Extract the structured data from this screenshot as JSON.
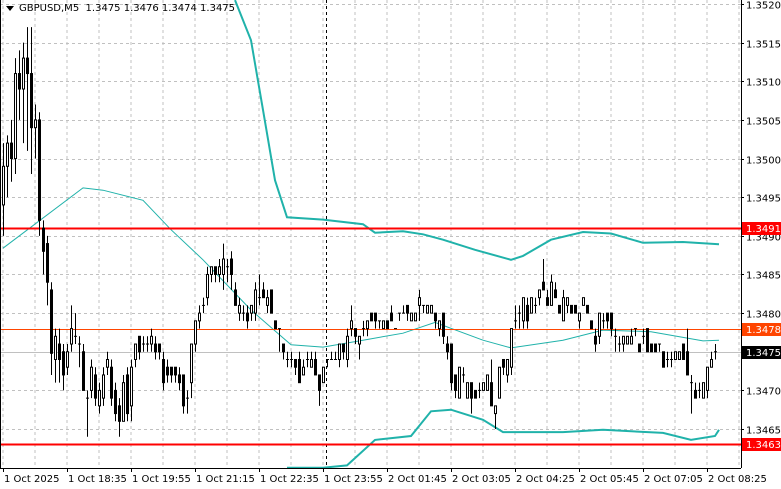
{
  "header": {
    "symbol": "GBPUSD,M5",
    "ohlc": "1.3475 1.3476 1.3474 1.3475"
  },
  "chart_data": {
    "type": "candlestick",
    "symbol": "GBPUSD",
    "timeframe": "M5",
    "ylim": [
      1.346,
      1.3521
    ],
    "grid": true,
    "y_ticks": [
      "1.3520",
      "1.3515",
      "1.3510",
      "1.3505",
      "1.3500",
      "1.3495",
      "1.3490",
      "1.3485",
      "1.3480",
      "1.3475",
      "1.3470",
      "1.3465"
    ],
    "x_ticks": [
      {
        "bar": 0,
        "label": "1 Oct 2025"
      },
      {
        "bar": 16,
        "label": "1 Oct 18:35"
      },
      {
        "bar": 32,
        "label": "1 Oct 19:55"
      },
      {
        "bar": 48,
        "label": "1 Oct 21:15"
      },
      {
        "bar": 64,
        "label": "1 Oct 22:35"
      },
      {
        "bar": 80,
        "label": "1 Oct 23:55"
      },
      {
        "bar": 96,
        "label": "2 Oct 01:45"
      },
      {
        "bar": 112,
        "label": "2 Oct 03:05"
      },
      {
        "bar": 128,
        "label": "2 Oct 04:25"
      },
      {
        "bar": 144,
        "label": "2 Oct 05:45"
      },
      {
        "bar": 160,
        "label": "2 Oct 07:05"
      },
      {
        "bar": 176,
        "label": "2 Oct 08:25"
      }
    ],
    "day_separator_bar": 81,
    "levels": [
      {
        "price": "1.3491",
        "color": "#ff0000",
        "style": "thick"
      },
      {
        "price": "1.3478",
        "color": "#ff4500",
        "style": "thin"
      },
      {
        "price": "1.3463",
        "color": "#ff0000",
        "style": "thick"
      }
    ],
    "bid": {
      "price": "1.3475",
      "color": "#000000"
    },
    "colors": {
      "band": "#20b2aa",
      "bull_fill": "#ffffff",
      "bear_fill": "#000000",
      "grid": "#c0c0c0"
    },
    "bands": {
      "middle": [
        [
          0,
          1.34884
        ],
        [
          20,
          1.34962
        ],
        [
          25,
          1.34959
        ],
        [
          35,
          1.34946
        ],
        [
          42,
          1.34908
        ],
        [
          50,
          1.34869
        ],
        [
          62,
          1.34804
        ],
        [
          72,
          1.34759
        ],
        [
          80,
          1.34756
        ],
        [
          90,
          1.34765
        ],
        [
          100,
          1.34774
        ],
        [
          108,
          1.34788
        ],
        [
          120,
          1.34765
        ],
        [
          127,
          1.34755
        ],
        [
          140,
          1.34765
        ],
        [
          150,
          1.34778
        ],
        [
          162,
          1.34776
        ],
        [
          175,
          1.34764
        ],
        [
          179,
          1.34765
        ]
      ],
      "upper": [
        [
          58,
          1.35205
        ],
        [
          62,
          1.35153
        ],
        [
          65,
          1.35063
        ],
        [
          68,
          1.34972
        ],
        [
          71,
          1.34924
        ],
        [
          80,
          1.34921
        ],
        [
          90,
          1.34915
        ],
        [
          93,
          1.34904
        ],
        [
          100,
          1.34906
        ],
        [
          105,
          1.34902
        ],
        [
          110,
          1.34895
        ],
        [
          118,
          1.34882
        ],
        [
          127,
          1.34869
        ],
        [
          130,
          1.34874
        ],
        [
          137,
          1.34895
        ],
        [
          145,
          1.34905
        ],
        [
          152,
          1.34903
        ],
        [
          160,
          1.34891
        ],
        [
          170,
          1.34892
        ],
        [
          179,
          1.34889
        ]
      ],
      "lower": [
        [
          71,
          1.346
        ],
        [
          80,
          1.346
        ],
        [
          86,
          1.34603
        ],
        [
          93,
          1.34636
        ],
        [
          102,
          1.34641
        ],
        [
          107,
          1.34673
        ],
        [
          112,
          1.34675
        ],
        [
          120,
          1.34662
        ],
        [
          125,
          1.34646
        ],
        [
          140,
          1.34646
        ],
        [
          150,
          1.34649
        ],
        [
          165,
          1.34645
        ],
        [
          172,
          1.34636
        ],
        [
          178,
          1.34641
        ],
        [
          179,
          1.34649
        ]
      ]
    },
    "candles": [
      [
        1.3494,
        1.3502,
        1.349,
        1.3499
      ],
      [
        1.3499,
        1.3503,
        1.3495,
        1.3502
      ],
      [
        1.3502,
        1.3505,
        1.3497,
        1.35
      ],
      [
        1.35,
        1.3513,
        1.3498,
        1.3511
      ],
      [
        1.3511,
        1.3514,
        1.3505,
        1.3509
      ],
      [
        1.3509,
        1.3515,
        1.3502,
        1.3513
      ],
      [
        1.3513,
        1.3517,
        1.3501,
        1.3511
      ],
      [
        1.3511,
        1.3517,
        1.3498,
        1.3504
      ],
      [
        1.3504,
        1.3507,
        1.35,
        1.3505
      ],
      [
        1.3505,
        1.3506,
        1.349,
        1.3492
      ],
      [
        1.3491,
        1.3492,
        1.3485,
        1.3488
      ],
      [
        1.3489,
        1.349,
        1.3481,
        1.3484
      ],
      [
        1.3483,
        1.3484,
        1.3472,
        1.34748
      ],
      [
        1.3474,
        1.3478,
        1.3471,
        1.3477
      ],
      [
        1.3476,
        1.3478,
        1.3471,
        1.3474
      ],
      [
        1.3475,
        1.3476,
        1.347,
        1.3472
      ],
      [
        1.3473,
        1.3476,
        1.3472,
        1.3475
      ],
      [
        1.3476,
        1.3481,
        1.3475,
        1.3478
      ],
      [
        1.3477,
        1.348,
        1.3476,
        1.3477
      ],
      [
        1.3476,
        1.3477,
        1.3473,
        1.3476
      ],
      [
        1.3475,
        1.3476,
        1.347,
        1.347
      ],
      [
        1.3469,
        1.347,
        1.3464,
        1.3469
      ],
      [
        1.347,
        1.3474,
        1.3469,
        1.3473
      ],
      [
        1.3472,
        1.3473,
        1.3468,
        1.3469
      ],
      [
        1.3468,
        1.3471,
        1.3467,
        1.347
      ],
      [
        1.3469,
        1.3473,
        1.3468,
        1.3472
      ],
      [
        1.3473,
        1.3475,
        1.3472,
        1.3474
      ],
      [
        1.3473,
        1.3474,
        1.3468,
        1.3469
      ],
      [
        1.347,
        1.3471,
        1.3466,
        1.3467
      ],
      [
        1.3468,
        1.3469,
        1.3464,
        1.3466
      ],
      [
        1.3466,
        1.3472,
        1.3466,
        1.3471
      ],
      [
        1.3472,
        1.3473,
        1.3466,
        1.3467
      ],
      [
        1.3468,
        1.3474,
        1.3466,
        1.3473
      ],
      [
        1.3474,
        1.3476,
        1.3473,
        1.3476
      ],
      [
        1.3477,
        1.3477,
        1.3474,
        1.3475
      ],
      [
        1.3476,
        1.3477,
        1.3475,
        1.3476
      ],
      [
        1.3476,
        1.3477,
        1.3475,
        1.3476
      ],
      [
        1.3476,
        1.3478,
        1.3475,
        1.3477
      ],
      [
        1.3476,
        1.3477,
        1.3474,
        1.3475
      ],
      [
        1.3476,
        1.3476,
        1.3474,
        1.3475
      ],
      [
        1.3474,
        1.3475,
        1.347,
        1.3471
      ],
      [
        1.3473,
        1.3474,
        1.3471,
        1.3472
      ],
      [
        1.3473,
        1.3473,
        1.3471,
        1.3472
      ],
      [
        1.3473,
        1.3473,
        1.3471,
        1.3472
      ],
      [
        1.3472,
        1.3473,
        1.347,
        1.3471
      ],
      [
        1.3472,
        1.3472,
        1.3467,
        1.3468
      ],
      [
        1.3469,
        1.347,
        1.3467,
        1.3469
      ],
      [
        1.3471,
        1.3476,
        1.3469,
        1.3476
      ],
      [
        1.3476,
        1.3479,
        1.3475,
        1.3479
      ],
      [
        1.3479,
        1.3481,
        1.3478,
        1.348
      ],
      [
        1.3481,
        1.3482,
        1.348,
        1.3481
      ],
      [
        1.3482,
        1.3486,
        1.3481,
        1.3485
      ],
      [
        1.3485,
        1.3486,
        1.3484,
        1.3486
      ],
      [
        1.3486,
        1.3486,
        1.3484,
        1.3485
      ],
      [
        1.3485,
        1.3487,
        1.3484,
        1.3486
      ],
      [
        1.3485,
        1.3489,
        1.3483,
        1.3487
      ],
      [
        1.3486,
        1.3487,
        1.3484,
        1.3486
      ],
      [
        1.3487,
        1.3488,
        1.3483,
        1.3485
      ],
      [
        1.3483,
        1.3484,
        1.3481,
        1.3481
      ],
      [
        1.348,
        1.3482,
        1.3479,
        1.3481
      ],
      [
        1.348,
        1.3481,
        1.3479,
        1.348
      ],
      [
        1.348,
        1.3481,
        1.3478,
        1.3479
      ],
      [
        1.348,
        1.3481,
        1.3479,
        1.3481
      ],
      [
        1.348,
        1.3484,
        1.3479,
        1.3483
      ],
      [
        1.3482,
        1.3485,
        1.3481,
        1.3482
      ],
      [
        1.3483,
        1.3484,
        1.3482,
        1.3482
      ],
      [
        1.3481,
        1.3483,
        1.348,
        1.3482
      ],
      [
        1.3483,
        1.3483,
        1.348,
        1.348
      ],
      [
        1.3479,
        1.3479,
        1.3478,
        1.3478
      ],
      [
        1.3478,
        1.3478,
        1.3475,
        1.3478
      ],
      [
        1.3476,
        1.3476,
        1.3474,
        1.3475
      ],
      [
        1.3474,
        1.3475,
        1.3473,
        1.3474
      ],
      [
        1.3474,
        1.3475,
        1.3473,
        1.3474
      ],
      [
        1.3474,
        1.3474,
        1.3472,
        1.3473
      ],
      [
        1.3474,
        1.3475,
        1.3471,
        1.3471
      ],
      [
        1.3472,
        1.3474,
        1.3472,
        1.3473
      ],
      [
        1.3474,
        1.3475,
        1.3473,
        1.3474
      ],
      [
        1.3473,
        1.3475,
        1.3473,
        1.3474
      ],
      [
        1.3474,
        1.3475,
        1.3472,
        1.3472
      ],
      [
        1.3472,
        1.3472,
        1.3468,
        1.347
      ],
      [
        1.3471,
        1.3473,
        1.3471,
        1.3473
      ],
      [
        1.3474,
        1.3474,
        1.3473,
        1.3474
      ],
      [
        1.3474,
        1.3475,
        1.3474,
        1.3474
      ],
      [
        1.3474,
        1.3475,
        1.3474,
        1.3474
      ],
      [
        1.3474,
        1.3476,
        1.3473,
        1.3476
      ],
      [
        1.3476,
        1.3476,
        1.3474,
        1.3475
      ],
      [
        1.3474,
        1.3478,
        1.3473,
        1.3477
      ],
      [
        1.3478,
        1.3481,
        1.3477,
        1.3479
      ],
      [
        1.3478,
        1.3478,
        1.3476,
        1.3477
      ],
      [
        1.3476,
        1.3477,
        1.3474,
        1.3477
      ],
      [
        1.3478,
        1.3479,
        1.3477,
        1.3478
      ],
      [
        1.3478,
        1.3479,
        1.3477,
        1.3479
      ],
      [
        1.348,
        1.348,
        1.3479,
        1.3479
      ],
      [
        1.348,
        1.348,
        1.3478,
        1.3479
      ],
      [
        1.3479,
        1.3479,
        1.3478,
        1.3479
      ],
      [
        1.3478,
        1.3479,
        1.3478,
        1.3479
      ],
      [
        1.3479,
        1.3479,
        1.3478,
        1.3478
      ],
      [
        1.348,
        1.3481,
        1.3479,
        1.3479
      ],
      [
        1.3478,
        1.3478,
        1.3478,
        1.3478
      ],
      [
        1.348,
        1.348,
        1.3479,
        1.348
      ],
      [
        1.348,
        1.3481,
        1.348,
        1.348
      ],
      [
        1.3481,
        1.3481,
        1.3479,
        1.348
      ],
      [
        1.3479,
        1.348,
        1.3479,
        1.348
      ],
      [
        1.3479,
        1.348,
        1.3479,
        1.348
      ],
      [
        1.3481,
        1.3483,
        1.3479,
        1.3482
      ],
      [
        1.3481,
        1.3481,
        1.348,
        1.3481
      ],
      [
        1.348,
        1.3481,
        1.348,
        1.3481
      ],
      [
        1.348,
        1.3481,
        1.348,
        1.3481
      ],
      [
        1.348,
        1.348,
        1.3478,
        1.3479
      ],
      [
        1.3478,
        1.3479,
        1.3477,
        1.3479
      ],
      [
        1.348,
        1.348,
        1.3476,
        1.3477
      ],
      [
        1.3476,
        1.3477,
        1.3474,
        1.3475
      ],
      [
        1.3476,
        1.3476,
        1.347,
        1.3471
      ],
      [
        1.3472,
        1.3472,
        1.3469,
        1.347
      ],
      [
        1.3469,
        1.3473,
        1.3469,
        1.3473
      ],
      [
        1.3472,
        1.3473,
        1.3471,
        1.3472
      ],
      [
        1.3469,
        1.3471,
        1.3469,
        1.3471
      ],
      [
        1.3471,
        1.3471,
        1.3467,
        1.3469
      ],
      [
        1.347,
        1.347,
        1.3469,
        1.3469
      ],
      [
        1.347,
        1.3471,
        1.3469,
        1.347
      ],
      [
        1.347,
        1.3471,
        1.347,
        1.3471
      ],
      [
        1.347,
        1.3472,
        1.347,
        1.3472
      ],
      [
        1.3471,
        1.3474,
        1.3468,
        1.3468
      ],
      [
        1.3467,
        1.3468,
        1.3465,
        1.3468
      ],
      [
        1.3469,
        1.3473,
        1.3469,
        1.3473
      ],
      [
        1.3474,
        1.3474,
        1.3472,
        1.3473
      ],
      [
        1.3472,
        1.3474,
        1.3471,
        1.3474
      ],
      [
        1.3473,
        1.3478,
        1.3472,
        1.3478
      ],
      [
        1.3479,
        1.3481,
        1.3478,
        1.3479
      ],
      [
        1.348,
        1.3481,
        1.3478,
        1.348
      ],
      [
        1.3479,
        1.3482,
        1.3478,
        1.3482
      ],
      [
        1.3481,
        1.3482,
        1.3478,
        1.3479
      ],
      [
        1.348,
        1.3482,
        1.348,
        1.3482
      ],
      [
        1.3481,
        1.3482,
        1.348,
        1.3481
      ],
      [
        1.3482,
        1.3483,
        1.3481,
        1.3483
      ],
      [
        1.3484,
        1.3487,
        1.3483,
        1.3483
      ],
      [
        1.3482,
        1.3483,
        1.3481,
        1.3481
      ],
      [
        1.3481,
        1.3485,
        1.3481,
        1.3484
      ],
      [
        1.3483,
        1.3484,
        1.3482,
        1.3482
      ],
      [
        1.3481,
        1.3481,
        1.348,
        1.348
      ],
      [
        1.3479,
        1.3483,
        1.3479,
        1.3482
      ],
      [
        1.3481,
        1.3482,
        1.348,
        1.3482
      ],
      [
        1.3481,
        1.3481,
        1.348,
        1.348
      ],
      [
        1.3481,
        1.3481,
        1.348,
        1.348
      ],
      [
        1.3479,
        1.348,
        1.3478,
        1.348
      ],
      [
        1.3481,
        1.3482,
        1.3481,
        1.3482
      ],
      [
        1.3481,
        1.3481,
        1.348,
        1.348
      ],
      [
        1.3479,
        1.3479,
        1.3478,
        1.3478
      ],
      [
        1.3477,
        1.3478,
        1.3475,
        1.3476
      ],
      [
        1.3477,
        1.348,
        1.3476,
        1.348
      ],
      [
        1.3479,
        1.348,
        1.3478,
        1.3479
      ],
      [
        1.348,
        1.348,
        1.3478,
        1.3479
      ],
      [
        1.348,
        1.348,
        1.3477,
        1.3478
      ],
      [
        1.3477,
        1.3478,
        1.3475,
        1.3477
      ],
      [
        1.3476,
        1.3477,
        1.3475,
        1.3476
      ],
      [
        1.3476,
        1.3477,
        1.3475,
        1.3477
      ],
      [
        1.3476,
        1.3477,
        1.3476,
        1.3477
      ],
      [
        1.3476,
        1.3478,
        1.3476,
        1.3477
      ],
      [
        1.3478,
        1.3478,
        1.3477,
        1.3478
      ],
      [
        1.3476,
        1.3476,
        1.3475,
        1.3475
      ],
      [
        1.3477,
        1.3478,
        1.3476,
        1.3477
      ],
      [
        1.3478,
        1.3478,
        1.3475,
        1.3475
      ],
      [
        1.3476,
        1.3476,
        1.3475,
        1.3475
      ],
      [
        1.3476,
        1.3476,
        1.3475,
        1.3475
      ],
      [
        1.3476,
        1.3476,
        1.3475,
        1.3476
      ],
      [
        1.3475,
        1.3475,
        1.3473,
        1.3473
      ],
      [
        1.3474,
        1.3475,
        1.3473,
        1.3474
      ],
      [
        1.3474,
        1.3475,
        1.3473,
        1.3474
      ],
      [
        1.3474,
        1.3475,
        1.3474,
        1.3475
      ],
      [
        1.3474,
        1.3475,
        1.3474,
        1.3475
      ],
      [
        1.3476,
        1.3476,
        1.3474,
        1.3474
      ],
      [
        1.3475,
        1.3478,
        1.3472,
        1.3472
      ],
      [
        1.3471,
        1.3472,
        1.3467,
        1.3471
      ],
      [
        1.347,
        1.3471,
        1.3469,
        1.3469
      ],
      [
        1.347,
        1.3471,
        1.3469,
        1.347
      ],
      [
        1.3469,
        1.3471,
        1.3469,
        1.3471
      ],
      [
        1.347,
        1.3473,
        1.3469,
        1.3473
      ],
      [
        1.3473,
        1.3475,
        1.3473,
        1.3474
      ],
      [
        1.3475,
        1.3476,
        1.3474,
        1.3475
      ]
    ]
  }
}
